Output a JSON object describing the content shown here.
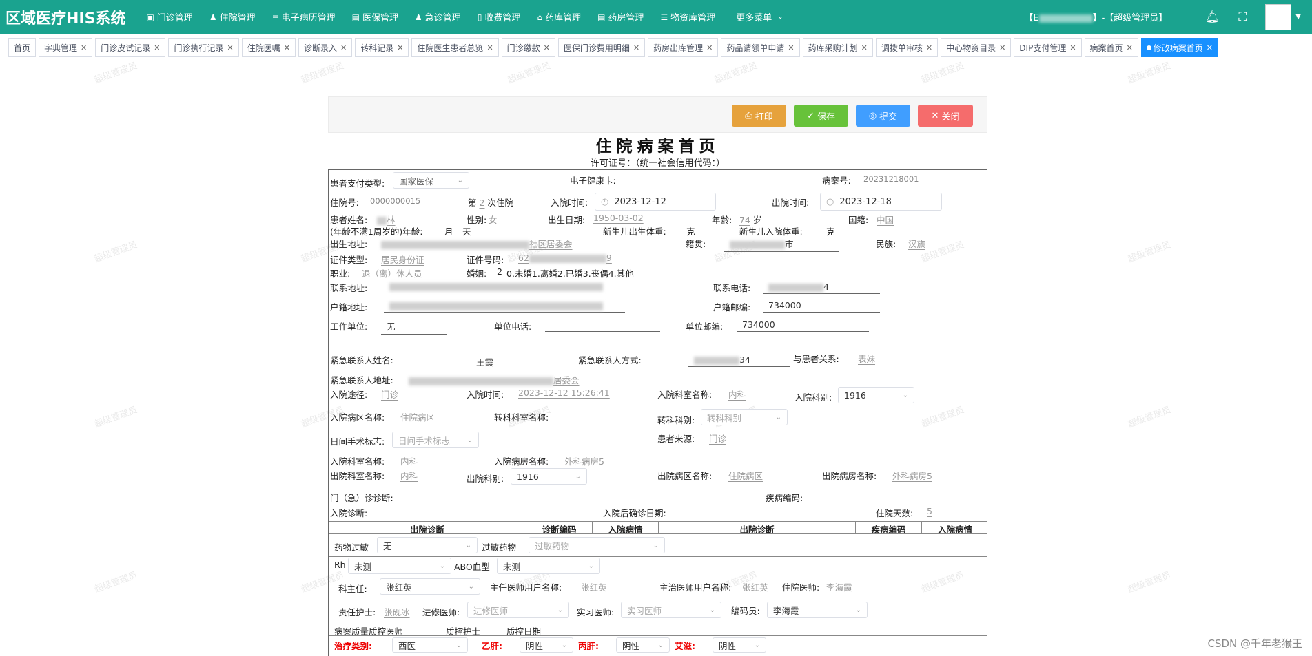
{
  "app": {
    "title": "区域医疗HIS系统"
  },
  "nav": [
    {
      "label": "门诊管理",
      "icon": "▣"
    },
    {
      "label": "住院管理",
      "icon": "♟"
    },
    {
      "label": "电子病历管理",
      "icon": "≡"
    },
    {
      "label": "医保管理",
      "icon": "▤"
    },
    {
      "label": "急诊管理",
      "icon": "♟"
    },
    {
      "label": "收费管理",
      "icon": "▯"
    },
    {
      "label": "药库管理",
      "icon": "⌂"
    },
    {
      "label": "药房管理",
      "icon": "▤"
    },
    {
      "label": "物资库管理",
      "icon": "☰"
    },
    {
      "label": "更多菜单",
      "icon": ""
    }
  ],
  "user": {
    "prefix": "【E",
    "suffix": "】-【超级管理员】"
  },
  "tabs": [
    {
      "label": "首页",
      "closable": false
    },
    {
      "label": "字典管理"
    },
    {
      "label": "门诊皮试记录"
    },
    {
      "label": "门诊执行记录"
    },
    {
      "label": "住院医嘱"
    },
    {
      "label": "诊断录入"
    },
    {
      "label": "转科记录"
    },
    {
      "label": "住院医生患者总览"
    },
    {
      "label": "门诊缴款"
    },
    {
      "label": "医保门诊费用明细"
    },
    {
      "label": "药房出库管理"
    },
    {
      "label": "药品请领单申请"
    },
    {
      "label": "药库采购计划"
    },
    {
      "label": "调拨单审核"
    },
    {
      "label": "中心物资目录"
    },
    {
      "label": "DIP支付管理"
    },
    {
      "label": "病案首页"
    },
    {
      "label": "修改病案首页",
      "active": true
    }
  ],
  "watermark": "超级管理员",
  "toolbar": {
    "print": "打印",
    "save": "保存",
    "submit": "提交",
    "close": "关闭"
  },
  "doc": {
    "title": "住院病案首页",
    "subtitle": "许可证号：（统一社会信用代码：）"
  },
  "form": {
    "pay_type_label": "患者支付类型:",
    "pay_type": "国家医保",
    "ehealth_label": "电子健康卡:",
    "case_no_label": "病案号:",
    "case_no": "20231218001",
    "inpatient_no_label": "住院号:",
    "inpatient_no": "0000000015",
    "times_pre": "第",
    "times": "2",
    "times_suf": "次住院",
    "admit_time_label": "入院时间:",
    "admit_date": "2023-12-12",
    "discharge_time_label": "出院时间:",
    "discharge_date": "2023-12-18",
    "name_label": "患者姓名:",
    "name_vis": "林",
    "gender_label": "性别:",
    "gender": "女",
    "birth_label": "出生日期:",
    "birth": "1950-03-02",
    "age_label": "年龄:",
    "age": "74",
    "age_unit": "岁",
    "nation_label": "国籍:",
    "nation": "中国",
    "infant_age_label": "(年龄不满1周岁的)年龄:",
    "month": "月",
    "day": "天",
    "newborn_weight_label": "新生儿出生体重:",
    "g1": "克",
    "newborn_admit_weight_label": "新生儿入院体重:",
    "g2": "克",
    "birthplace_label": "出生地址:",
    "birthplace_vis": "社区居委会",
    "native_label": "籍贯:",
    "native_vis": "市",
    "ethnic_label": "民族:",
    "ethnic": "汉族",
    "id_type_label": "证件类型:",
    "id_type": "居民身份证",
    "id_no_label": "证件号码:",
    "id_no_pre": "62",
    "id_no_suf": "9",
    "job_label": "职业:",
    "job": "退（离）休人员",
    "marital_label": "婚姻:",
    "marital": "2",
    "marital_opts": "0.未婚1.离婚2.已婚3.丧偶4.其他",
    "contact_addr_label": "联系地址:",
    "phone_label": "联系电话:",
    "phone_suf": "4",
    "reg_addr_label": "户籍地址:",
    "reg_zip_label": "户籍邮编:",
    "reg_zip": "734000",
    "work_label": "工作单位:",
    "work": "无",
    "work_phone_label": "单位电话:",
    "work_zip_label": "单位邮编:",
    "work_zip": "734000",
    "emg_name_label": "紧急联系人姓名:",
    "emg_name": "王霞",
    "emg_phone_label": "紧急联系人方式:",
    "emg_phone_suf": "34",
    "relation_label": "与患者关系:",
    "relation": "表妹",
    "emg_addr_label": "紧急联系人地址:",
    "emg_addr_vis": "居委会",
    "admit_way_label": "入院途径:",
    "admit_way": "门诊",
    "admit_time2_label": "入院时间:",
    "admit_time2": "2023-12-12 15:26:41",
    "admit_dept_label": "入院科室名称:",
    "admit_dept": "内科",
    "admit_subj_label": "入院科别:",
    "admit_subj": "1916",
    "admit_ward_label": "入院病区名称:",
    "admit_ward": "住院病区",
    "transfer_dept_label": "转科科室名称:",
    "transfer_subj_label": "转科科别:",
    "transfer_subj": "转科科别",
    "day_surgery_label": "日间手术标志:",
    "day_surgery": "日间手术标志",
    "source_label": "患者来源:",
    "source": "门诊",
    "admit_dept2_label": "入院科室名称:",
    "admit_dept2": "内科",
    "admit_room_label": "入院病房名称:",
    "admit_room": "外科病房5",
    "dis_dept_label": "出院科室名称:",
    "dis_dept": "内科",
    "dis_subj_label": "出院科别:",
    "dis_subj": "1916",
    "dis_ward_label": "出院病区名称:",
    "dis_ward": "住院病区",
    "dis_room_label": "出院病房名称:",
    "dis_room": "外科病房5",
    "er_diag_label": "门（急）诊诊断:",
    "disease_code_label": "疾病编码:",
    "admit_diag_label": "入院诊断:",
    "confirm_date_label": "入院后确诊日期:",
    "days_label": "住院天数:",
    "days": "5",
    "diag_head": [
      "出院诊断",
      "诊断编码",
      "入院病情",
      "出院诊断",
      "疾病编码",
      "入院病情"
    ],
    "allergy_label": "药物过敏",
    "allergy": "无",
    "allergy_drug_label": "过敏药物",
    "allergy_drug": "过敏药物",
    "rh_label": "Rh",
    "rh": "未测",
    "abo_label": "ABO血型",
    "abo": "未测",
    "director_label": "科主任:",
    "director": "张红英",
    "chief_label": "主任医师用户名称:",
    "chief": "张红英",
    "attending_label": "主治医师用户名称:",
    "attending": "张红英",
    "resident_label": "住院医师:",
    "resident": "李海霞",
    "nurse_label": "责任护士:",
    "nurse": "张砚冰",
    "advanced_label": "进修医师:",
    "advanced": "进修医师",
    "intern_label": "实习医师:",
    "intern": "实习医师",
    "coder_label": "编码员:",
    "coder": "李海霞",
    "qc_doc_label": "病案质量质控医师",
    "qc_nurse_label": "质控护士",
    "qc_date_label": "质控日期",
    "treat_label": "治疗类别:",
    "treat": "西医",
    "hbv_label": "乙肝:",
    "hbv": "阴性",
    "hcv_label": "丙肝:",
    "hcv": "阴性",
    "hiv_label": "艾滋:",
    "hiv": "阴性"
  },
  "footer": {
    "credit": "CSDN @千年老猴王"
  }
}
